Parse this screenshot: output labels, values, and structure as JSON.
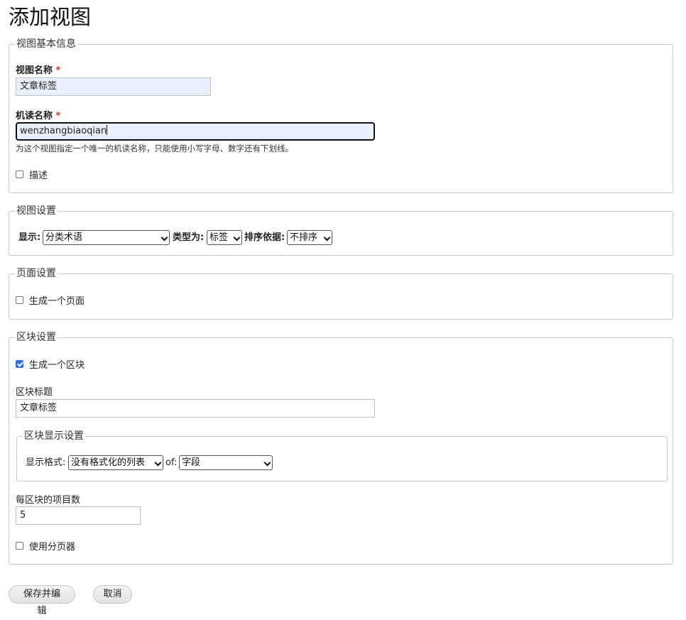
{
  "page": {
    "title": "添加视图"
  },
  "basic": {
    "legend": "视图基本信息",
    "view_name": {
      "label": "视图名称",
      "required": "*",
      "value": "文章标签"
    },
    "machine_name": {
      "label": "机读名称",
      "required": "*",
      "value": "wenzhangbiaoqian",
      "description": "为这个视图指定一个唯一的机读名称，只能使用小写字母、数字还有下划线。"
    },
    "description_checkbox": {
      "label": "描述",
      "checked": false
    }
  },
  "view_settings": {
    "legend": "视图设置",
    "show_label": "显示:",
    "show_value": "分类术语",
    "type_label": "类型为:",
    "type_value": "标签",
    "sort_label": "排序依据:",
    "sort_value": "不排序"
  },
  "page_settings": {
    "legend": "页面设置",
    "create_page": {
      "label": "生成一个页面",
      "checked": false
    }
  },
  "block_settings": {
    "legend": "区块设置",
    "create_block": {
      "label": "生成一个区块",
      "checked": true
    },
    "block_title": {
      "label": "区块标题",
      "value": "文章标签"
    },
    "display": {
      "legend": "区块显示设置",
      "format_label": "显示格式:",
      "format_value": "没有格式化的列表",
      "of_label": "of:",
      "of_value": "字段"
    },
    "items_per_block": {
      "label": "每区块的项目数",
      "value": "5"
    },
    "use_pager": {
      "label": "使用分页器",
      "checked": false
    }
  },
  "actions": {
    "save": "保存并编辑",
    "cancel": "取消"
  },
  "colors": {
    "required": "#c0392b",
    "autofill_bg": "#e8f0fe",
    "checkbox_accent": "#2f6fe6"
  }
}
